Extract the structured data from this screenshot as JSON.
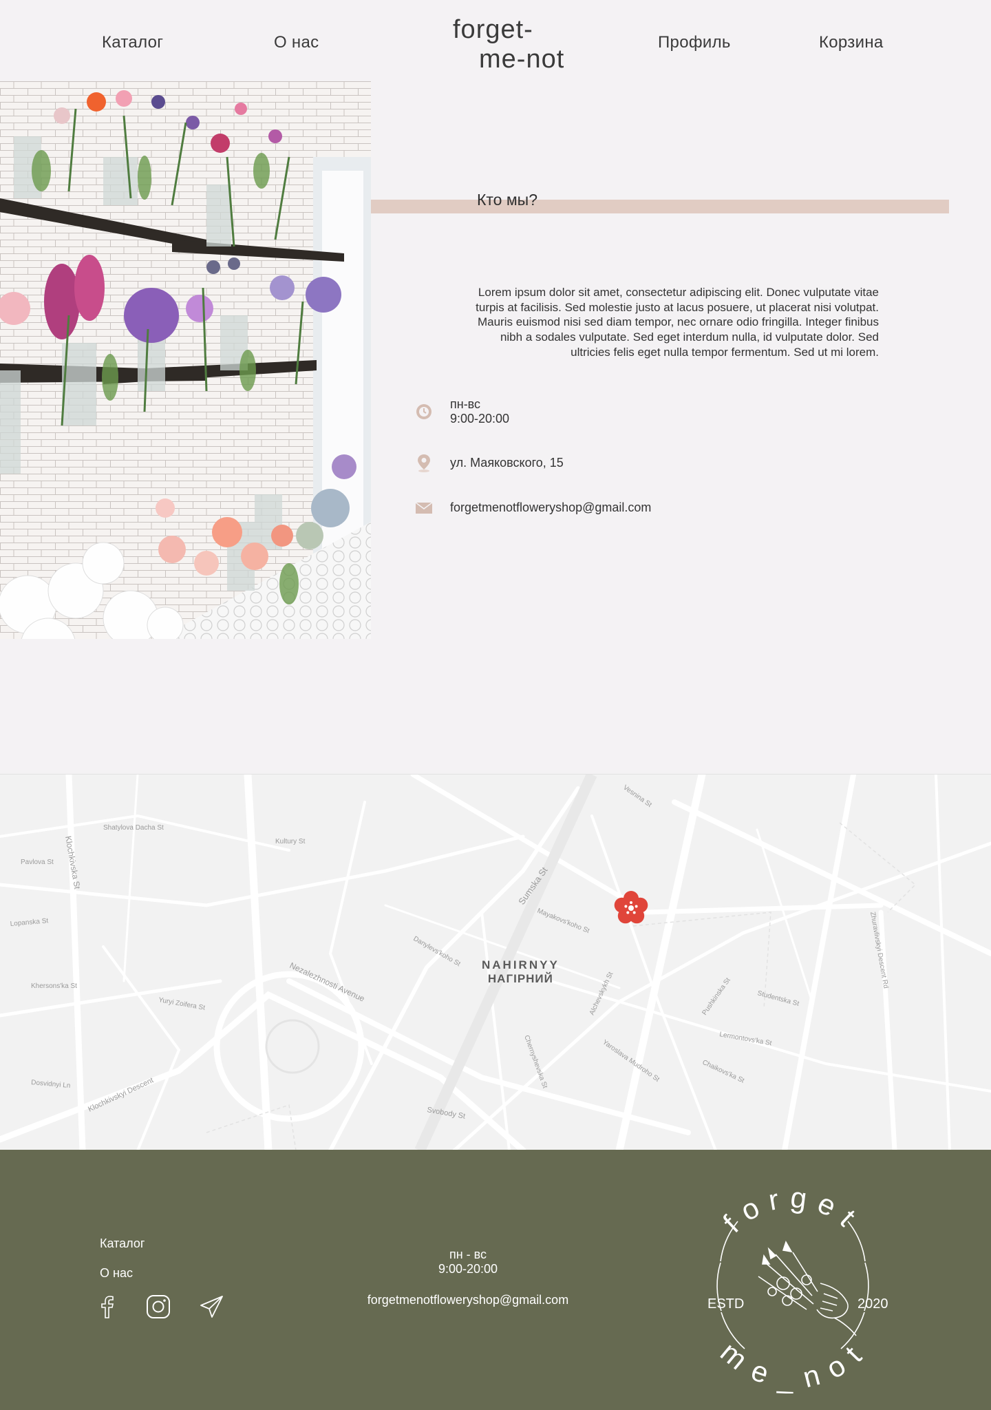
{
  "header": {
    "nav_catalog": "Каталог",
    "nav_about": "О нас",
    "logo_line1": "forget-",
    "logo_line2": "me-not",
    "nav_profile": "Профиль",
    "nav_cart": "Корзина"
  },
  "about": {
    "heading": "Кто мы?",
    "text": "Lorem ipsum dolor sit amet, consectetur adipiscing elit. Donec vulputate vitae turpis at facilisis. Sed molestie justo at lacus posuere, ut placerat nisi volutpat. Mauris euismod nisi sed diam tempor, nec ornare odio fringilla. Integer finibus nibh a sodales vulputate. Sed eget interdum nulla, id vulputate dolor. Sed ultricies felis eget nulla tempor fermentum. Sed ut mi lorem.",
    "hours_days": "пн-вс",
    "hours_time": "9:00-20:00",
    "address": "ул. Маяковского, 15",
    "email": "forgetmenotfloweryshop@gmail.com"
  },
  "map": {
    "district_latin": "NAHIRNYY",
    "district_cyrillic": "НАГІРНИЙ",
    "street_labels": [
      "Vesnina St",
      "Sumska St",
      "Mayakovs'koho St",
      "Nezalezhnosti Avenue",
      "Klochkivska St",
      "Pushkinska St",
      "Svobody St",
      "Zhuravlivskyi Descent Rd",
      "Klochkivskyi Descent",
      "Yaroslava Mudroho St",
      "Chernyshevska St",
      "Alchevskykh St",
      "Kultury St",
      "Danylevs'koho St",
      "Shatylova Dacha St",
      "Pavlova St",
      "Chaikovs'ka St",
      "Studentska St",
      "Lermontovs'ka St",
      "Yuryi Zoifera St",
      "Dosvidnyi Ln",
      "Khersons'ka St",
      "Lopanska St"
    ],
    "marker_color": "#e0453a"
  },
  "footer": {
    "link_catalog": "Каталог",
    "link_about": "О нас",
    "hours_days": "пн - вс",
    "hours_time": "9:00-20:00",
    "email": "forgetmenotfloweryshop@gmail.com",
    "social_icons": [
      "facebook-icon",
      "instagram-icon",
      "telegram-icon"
    ],
    "seal": {
      "top_text": "forget",
      "bottom_text": "me_not",
      "left_text": "ESTD",
      "right_text": "2020"
    }
  },
  "colors": {
    "background": "#f4f2f4",
    "accent_bar": "#e1ccc3",
    "footer": "#666a51",
    "icon": "#d4bcb1"
  }
}
